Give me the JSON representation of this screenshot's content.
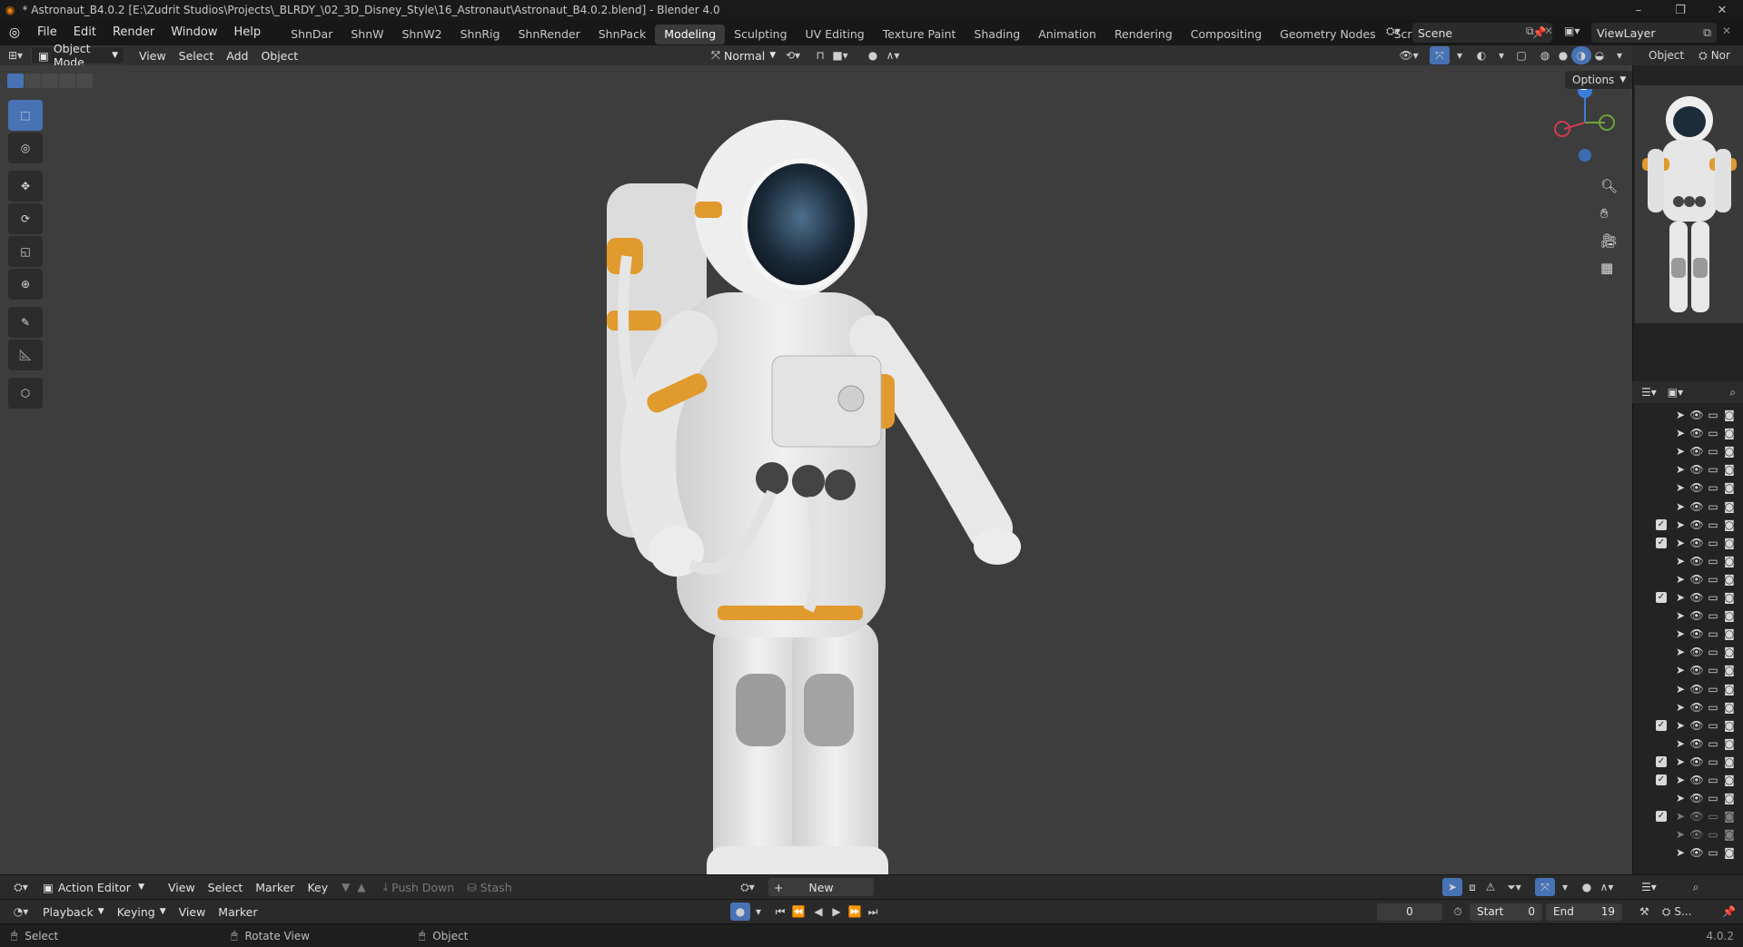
{
  "window": {
    "title": "* Astronaut_B4.0.2 [E:\\Zudrit Studios\\Projects\\_BLRDY_\\02_3D_Disney_Style\\16_Astronaut\\Astronaut_B4.0.2.blend] - Blender 4.0",
    "controls": [
      "–",
      "❐",
      "✕"
    ]
  },
  "menubar": {
    "items": [
      "File",
      "Edit",
      "Render",
      "Window",
      "Help"
    ],
    "workspaces": [
      "ShnDar",
      "ShnW",
      "ShnW2",
      "ShnRig",
      "ShnRender",
      "ShnPack",
      "Modeling",
      "Sculpting",
      "UV Editing",
      "Texture Paint",
      "Shading",
      "Animation",
      "Rendering",
      "Compositing",
      "Geometry Nodes",
      "Scripting"
    ],
    "active_workspace": "Modeling",
    "add_tab": "+",
    "scene": "Scene",
    "view_layer": "ViewLayer"
  },
  "viewport_header": {
    "mode": "Object Mode",
    "menus": [
      "View",
      "Select",
      "Add",
      "Object"
    ],
    "orientation": "Normal",
    "options": "Options"
  },
  "gizmo": {
    "z_label": "Z"
  },
  "properties": {
    "tab": "Object",
    "tab2": "Nor"
  },
  "outliner": {
    "rows": [
      {
        "checkbox": false,
        "dim": false
      },
      {
        "checkbox": false,
        "dim": false
      },
      {
        "checkbox": false,
        "dim": false
      },
      {
        "checkbox": false,
        "dim": false
      },
      {
        "checkbox": false,
        "dim": false
      },
      {
        "checkbox": false,
        "dim": false
      },
      {
        "checkbox": true,
        "dim": false
      },
      {
        "checkbox": true,
        "dim": false
      },
      {
        "checkbox": false,
        "dim": false
      },
      {
        "checkbox": false,
        "dim": false
      },
      {
        "checkbox": true,
        "dim": false
      },
      {
        "checkbox": false,
        "dim": false
      },
      {
        "checkbox": false,
        "dim": false
      },
      {
        "checkbox": false,
        "dim": false
      },
      {
        "checkbox": false,
        "dim": false
      },
      {
        "checkbox": false,
        "dim": false
      },
      {
        "checkbox": false,
        "dim": false
      },
      {
        "checkbox": true,
        "dim": false
      },
      {
        "checkbox": false,
        "dim": false
      },
      {
        "checkbox": true,
        "dim": false
      },
      {
        "checkbox": true,
        "dim": false
      },
      {
        "checkbox": false,
        "dim": false
      },
      {
        "checkbox": true,
        "dim": true
      },
      {
        "checkbox": false,
        "dim": true
      },
      {
        "checkbox": false,
        "dim": false
      }
    ]
  },
  "action_editor": {
    "editor": "Action Editor",
    "menus": [
      "View",
      "Select",
      "Marker",
      "Key"
    ],
    "push_down": "Push Down",
    "stash": "Stash",
    "new_label": "New"
  },
  "timeline": {
    "menus": [
      "Playback",
      "Keying",
      "View",
      "Marker"
    ],
    "current_frame": "0",
    "start_label": "Start",
    "start": "0",
    "end_label": "End",
    "end": "19"
  },
  "statusbar": {
    "select": "Select",
    "rotate": "Rotate View",
    "object": "Object",
    "version": "4.0.2"
  },
  "right_panel_misc": {
    "s_label": "S..."
  }
}
